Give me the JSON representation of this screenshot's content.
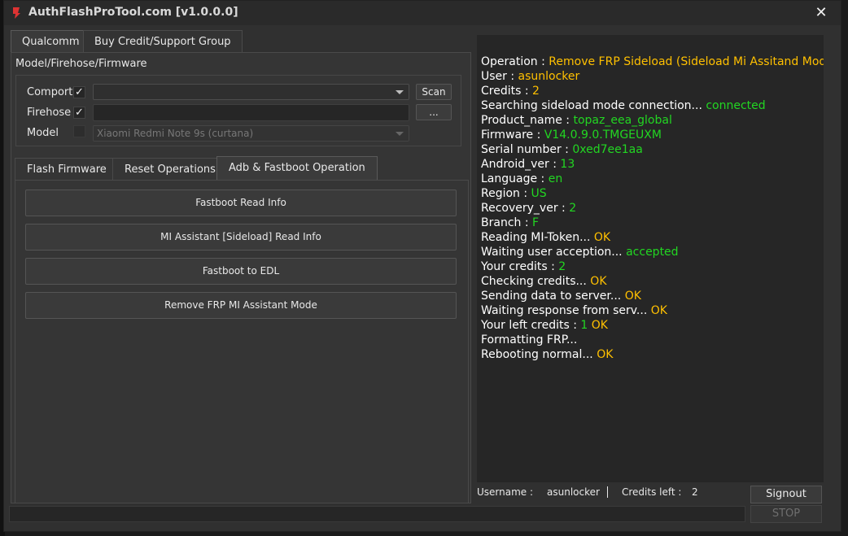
{
  "window": {
    "title": "AuthFlashProTool.com [v1.0.0.0]"
  },
  "top_tabs": [
    "Qualcomm",
    "Buy Credit/Support Group"
  ],
  "model_group": {
    "label": "Model/Firehose/Firmware",
    "comport": {
      "label": "Comport",
      "checked": true,
      "value": "",
      "scan_label": "Scan"
    },
    "firehose": {
      "label": "Firehose",
      "checked": true,
      "value": "",
      "browse_label": "..."
    },
    "model": {
      "label": "Model",
      "checked": false,
      "value": "Xiaomi Redmi Note 9s (curtana)"
    }
  },
  "inner_tabs": [
    "Flash Firmware",
    "Reset Operations",
    "Adb & Fastboot Operation"
  ],
  "operations": [
    "Fastboot Read Info",
    "MI Assistant [Sideload] Read Info",
    "Fastboot to EDL",
    "Remove FRP MI Assistant Mode"
  ],
  "log": [
    {
      "label": "Operation : ",
      "value": "Remove FRP Sideload (Sideload Mi Assitand Mode)",
      "color": "#ffc000"
    },
    {
      "label": "User : ",
      "value": "asunlocker",
      "color": "#ffc000"
    },
    {
      "label": "Credits : ",
      "value": "2",
      "color": "#ffc000"
    },
    {
      "label": "Searching sideload mode connection... ",
      "value": "connected",
      "color": "#22d622"
    },
    {
      "label": "Product_name : ",
      "value": "topaz_eea_global",
      "color": "#22d622"
    },
    {
      "label": "Firmware : ",
      "value": "V14.0.9.0.TMGEUXM",
      "color": "#22d622"
    },
    {
      "label": "Serial number : ",
      "value": "0xed7ee1aa",
      "color": "#22d622"
    },
    {
      "label": "Android_ver : ",
      "value": "13",
      "color": "#22d622"
    },
    {
      "label": "Language : ",
      "value": "en",
      "color": "#22d622"
    },
    {
      "label": "Region : ",
      "value": "US",
      "color": "#22d622"
    },
    {
      "label": "Recovery_ver : ",
      "value": "2",
      "color": "#22d622"
    },
    {
      "label": "Branch : ",
      "value": "F",
      "color": "#22d622"
    },
    {
      "label": "Reading MI-Token... ",
      "value": "OK",
      "color": "#ffc000"
    },
    {
      "label": "Waiting user acception... ",
      "value": "accepted",
      "color": "#22d622"
    },
    {
      "label": "Your credits : ",
      "value": "2",
      "color": "#22d622"
    },
    {
      "label": "Checking credits... ",
      "value": "OK",
      "color": "#ffc000"
    },
    {
      "label": "Sending data to server... ",
      "value": "OK",
      "color": "#ffc000"
    },
    {
      "label": "Waiting response from serv... ",
      "value": "OK",
      "color": "#ffc000"
    },
    {
      "label": "Your left credits : ",
      "value": "1",
      "color": "#22d622",
      "extra": " OK",
      "extra_color": "#ffc000"
    },
    {
      "label": "Formatting FRP...",
      "value": "",
      "color": "#ffc000"
    },
    {
      "label": "Rebooting normal... ",
      "value": "OK",
      "color": "#ffc000"
    }
  ],
  "status": {
    "username_label": "Username :",
    "username": "asunlocker",
    "credits_label": "Credits left :",
    "credits": "2"
  },
  "buttons": {
    "signout": "Signout",
    "stop": "STOP"
  },
  "colors": {
    "accent_yellow": "#ffc000",
    "accent_green": "#22d622"
  }
}
